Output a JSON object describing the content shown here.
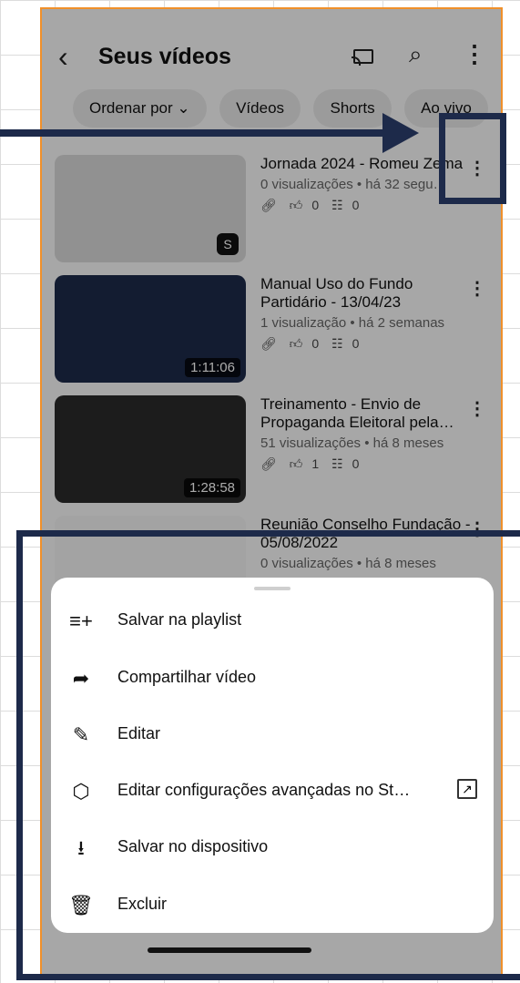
{
  "header": {
    "back_icon": "chevron-left-icon",
    "title": "Seus vídeos",
    "cast_icon": "cast-icon",
    "search_icon": "search-icon",
    "more_icon": "more-vertical-icon"
  },
  "chips": [
    "Ordenar por",
    "Vídeos",
    "Shorts",
    "Ao vivo"
  ],
  "videos": [
    {
      "title": "Jornada 2024 - Romeu Zema",
      "meta": "0 visualizações • há 32 segu…",
      "likes": "0",
      "comments": "0",
      "duration": ""
    },
    {
      "title": "Manual Uso do Fundo Partidário - 13/04/23",
      "meta": "1 visualização • há 2 semanas",
      "likes": "0",
      "comments": "0",
      "duration": "1:11:06"
    },
    {
      "title": "Treinamento - Envio de Propaganda Eleitoral pela…",
      "meta": "51 visualizações • há 8 meses",
      "likes": "1",
      "comments": "0",
      "duration": "1:28:58"
    },
    {
      "title": "Reunião Conselho Fundação - 05/08/2022",
      "meta": "0 visualizações • há 8 meses",
      "likes": "",
      "comments": "",
      "duration": ""
    }
  ],
  "sheet": {
    "items": [
      {
        "label": "Salvar na playlist",
        "icon": "playlist-add-icon"
      },
      {
        "label": "Compartilhar vídeo",
        "icon": "share-icon"
      },
      {
        "label": "Editar",
        "icon": "pencil-icon"
      },
      {
        "label": "Editar configurações avançadas no St…",
        "icon": "studio-icon"
      },
      {
        "label": "Salvar no dispositivo",
        "icon": "download-device-icon"
      },
      {
        "label": "Excluir",
        "icon": "trash-icon"
      }
    ]
  },
  "colors": {
    "annotation": "#1d2a4a",
    "frame": "#f0902a"
  }
}
